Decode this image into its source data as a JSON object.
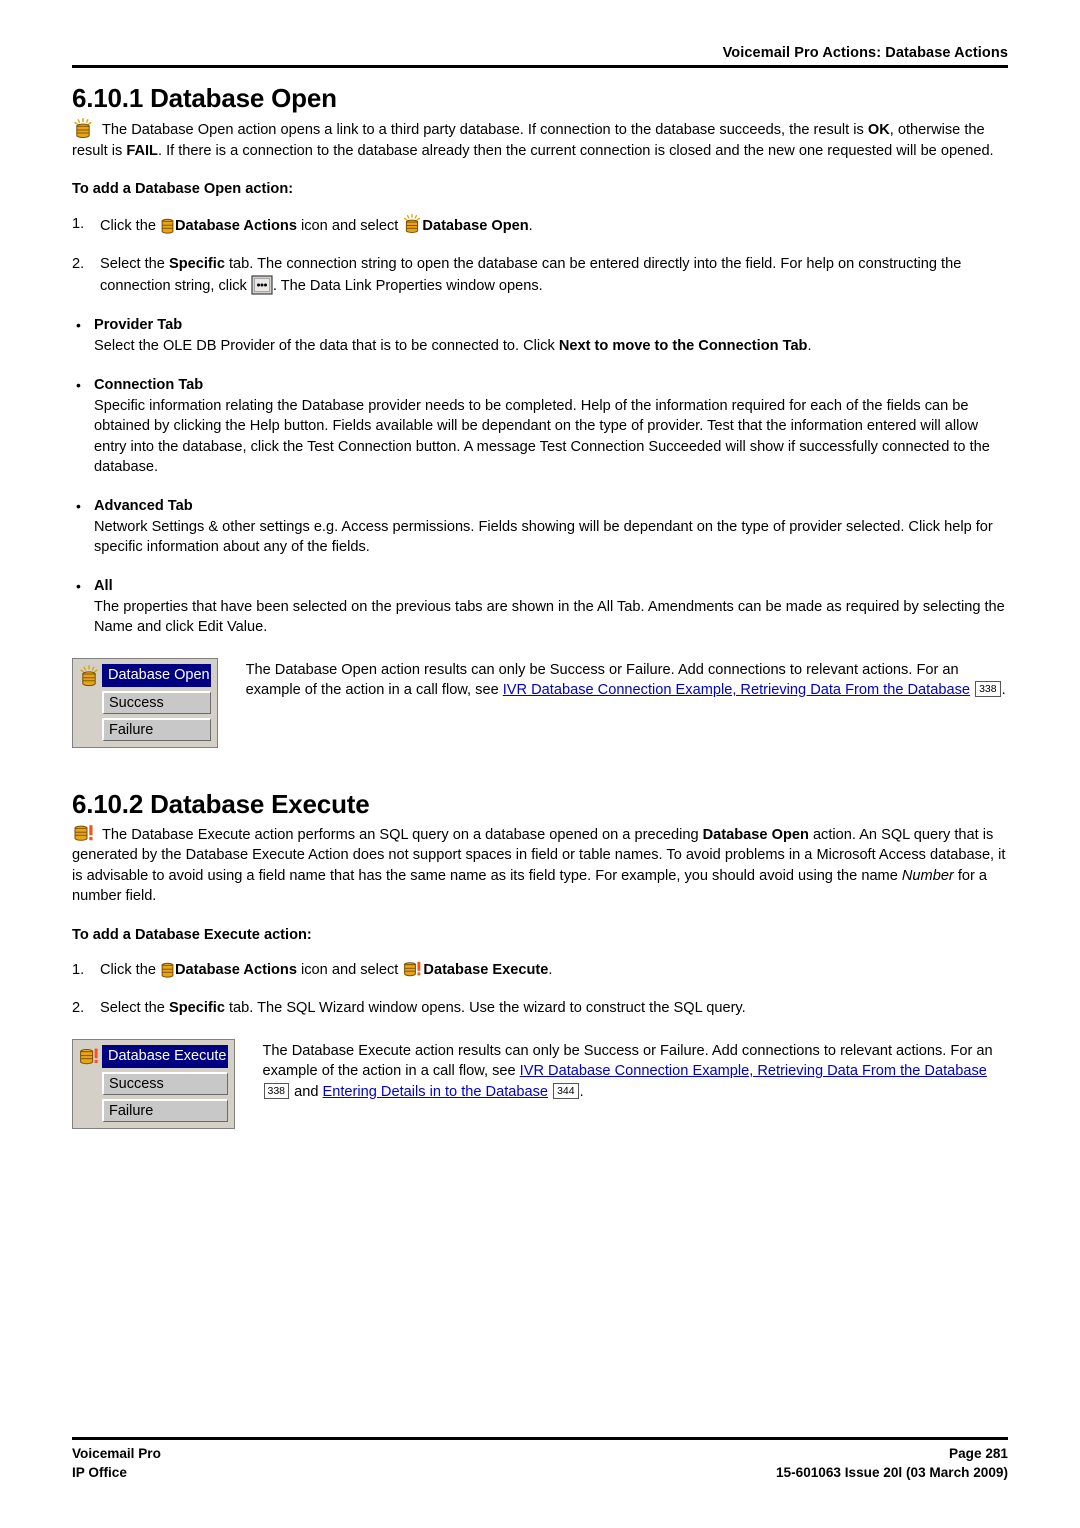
{
  "header": {
    "title": "Voicemail Pro Actions: Database Actions"
  },
  "sections": [
    {
      "number": "6.10.1",
      "heading": "6.10.1 Database Open",
      "lead_1": "The Database Open action opens a link to a third party database. If connection to the database succeeds, the result is ",
      "lead_ok": "OK",
      "lead_2": ", otherwise the result is ",
      "lead_fail": "FAIL",
      "lead_3": ". If there is a connection to the database already then the current connection is closed and the new one requested will be opened.",
      "subhead": "To add a Database Open action:",
      "step1": {
        "num": "1.",
        "t1": "Click the ",
        "bold1": "Database Actions",
        "t2": " icon and select ",
        "bold2": "Database Open",
        "t3": "."
      },
      "step2": {
        "num": "2.",
        "t1": "Select the ",
        "bold1": "Specific",
        "t2": " tab. The connection string to open the database can be entered directly into the field. For help on constructing the connection string, click ",
        "t3": ". The Data Link Properties window opens."
      },
      "bullets": [
        {
          "head": "Provider Tab",
          "t1": "Select the OLE DB Provider of the data that is to be connected to. Click ",
          "bold": "Next to move to the Connection Tab",
          "t2": "."
        },
        {
          "head": "Connection Tab",
          "t1": "Specific information relating the Database provider needs to be completed. Help of the information required for each of the fields can be obtained by clicking the Help button. Fields available will be dependant on the type of provider. Test that the information entered will allow entry into the database, click the Test Connection button. A message Test Connection Succeeded will show if successfully connected to the database.",
          "bold": "",
          "t2": ""
        },
        {
          "head": "Advanced Tab",
          "t1": "Network Settings & other settings e.g. Access permissions. Fields showing will be dependant on the type of provider selected. Click help for specific information about any of the fields.",
          "bold": "",
          "t2": ""
        },
        {
          "head": "All",
          "t1": "The properties that have been selected on the previous tabs are shown in the All Tab. Amendments can be made as required by selecting the Name and click Edit Value.",
          "bold": "",
          "t2": ""
        }
      ],
      "widget": {
        "title": "Database Open",
        "rows": [
          "Success",
          "Failure"
        ]
      },
      "shot_text": {
        "t1": "The Database Open action results can only be Success or Failure. Add connections to relevant actions. For an example of the action in a call flow, see ",
        "link1": "IVR Database Connection Example, Retrieving Data From the Database",
        "pageref1": "338",
        "t2": "."
      }
    },
    {
      "number": "6.10.2",
      "heading": "6.10.2 Database Execute",
      "lead_1": "The Database Execute action performs an SQL query on a database opened on a preceding ",
      "lead_bold": "Database Open",
      "lead_2": " action. An SQL query that is generated by the Database Execute Action does not support spaces in field or table names. To avoid problems in a Microsoft Access database, it is advisable to avoid using a field name that has the same name as its field type. For example, you should avoid using the name ",
      "lead_italic": "Number",
      "lead_3": " for a number field.",
      "subhead": "To add a Database Execute action:",
      "step1": {
        "num": "1.",
        "t1": "Click the ",
        "bold1": "Database Actions",
        "t2": " icon and select ",
        "bold2": "Database Execute",
        "t3": "."
      },
      "step2": {
        "num": "2.",
        "t1": "Select the ",
        "bold1": "Specific",
        "t2": " tab. The SQL Wizard window opens. Use the wizard to construct the SQL query."
      },
      "widget": {
        "title": "Database Execute",
        "rows": [
          "Success",
          "Failure"
        ]
      },
      "shot_text": {
        "t1": "The Database Execute action results can only be Success or Failure. Add connections to relevant actions. For an example of the action in a call flow, see ",
        "link1": "IVR Database Connection Example, Retrieving Data From the Database",
        "pageref1": "338",
        "t2": " and ",
        "link2": "Entering Details in to the Database",
        "pageref2": "344",
        "t3": "."
      }
    }
  ],
  "footer": {
    "left_line1": "Voicemail Pro",
    "left_line2": "IP Office",
    "right_line1": "Page 281",
    "right_line2": "15-601063 Issue 20l (03 March 2009)"
  },
  "colors": {
    "link": "#0000cc",
    "title_bar": "#000080",
    "widget_bg": "#d4d0c8",
    "row_bg": "#c8c8c8",
    "icon_gold": "#e8a317",
    "icon_dark": "#8a5a00",
    "exclaim": "#ff4500",
    "rays": "#ffd700"
  }
}
